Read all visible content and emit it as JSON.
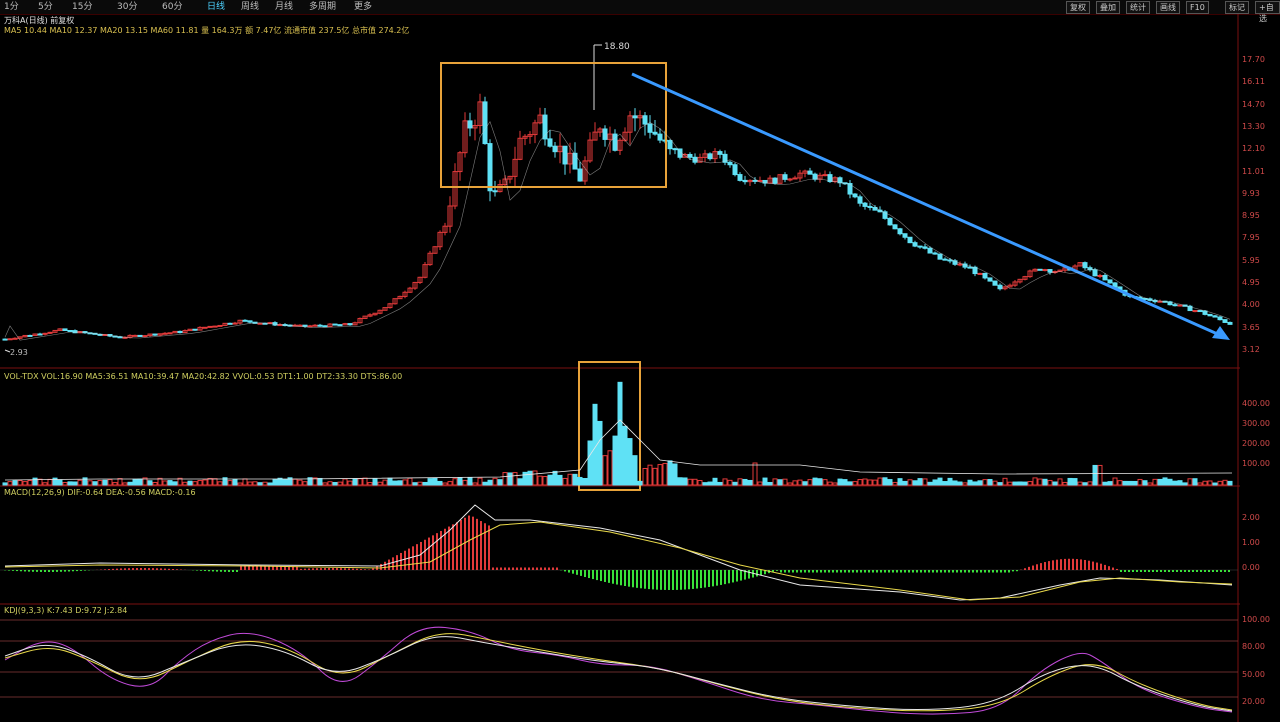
{
  "toolbar": {
    "periods": [
      "1分",
      "5分",
      "15分",
      "30分",
      "60分",
      "日线",
      "周线",
      "月线",
      "多周期",
      "更多"
    ],
    "active_index": 5,
    "right_buttons": [
      "复权",
      "叠加",
      "统计",
      "画线",
      "F10",
      "标记",
      "+自选",
      "返回"
    ]
  },
  "main_info": {
    "line1": "万科A(日线) 前复权",
    "line2": "MA5 10.44  MA10 12.37  MA20 13.15  MA60 11.81   量 164.3万  额 7.47亿   流通市值 237.5亿  总市值 274.2亿"
  },
  "volume_info": "VOL-TDX  VOL:16.90  MA5:36.51  MA10:39.47  MA20:42.82  VVOL:0.53  DT1:1.00  DT2:33.30  DTS:86.00",
  "macd_info": "MACD(12,26,9)  DIF:-0.64  DEA:-0.56  MACD:-0.16",
  "kdj_info": "KDJ(9,3,3)  K:7.43  D:9.72  J:2.84",
  "annotations": {
    "peak_label": "18.80",
    "low_label": "2.93"
  },
  "colors": {
    "up": "#e23a3a",
    "down": "#5fe1f5",
    "box": "#e8a33a",
    "trend_arrow": "#3a9aff",
    "ma_white": "#e8e8e8",
    "ma_yellow": "#e8d84a",
    "ma_purple": "#c04ad8"
  },
  "chart_data": [
    {
      "type": "candlestick",
      "name": "price",
      "ylabels": [
        "17.70",
        "16.11",
        "14.70",
        "13.30",
        "12.10",
        "11.01",
        "9.93",
        "8.95",
        "7.95",
        "5.95",
        "4.95",
        "4.00",
        "3.65",
        "3.12"
      ],
      "ylim": [
        2.5,
        19
      ],
      "annotations": [
        "box around peak 15.5–16.5 range",
        "falling trend arrow"
      ]
    },
    {
      "type": "bar",
      "name": "volume",
      "ylabels": [
        "400.00",
        "300.00",
        "200.00",
        "100.00"
      ],
      "ylim": [
        0,
        450
      ]
    },
    {
      "type": "bar",
      "name": "macd",
      "ylabels": [
        "2.00",
        "1.00",
        "0.00"
      ],
      "ylim": [
        -1,
        2.5
      ]
    },
    {
      "type": "line",
      "name": "kdj",
      "ylabels": [
        "100.00",
        "80.00",
        "50.00",
        "20.00"
      ],
      "ylim": [
        0,
        100
      ]
    }
  ]
}
